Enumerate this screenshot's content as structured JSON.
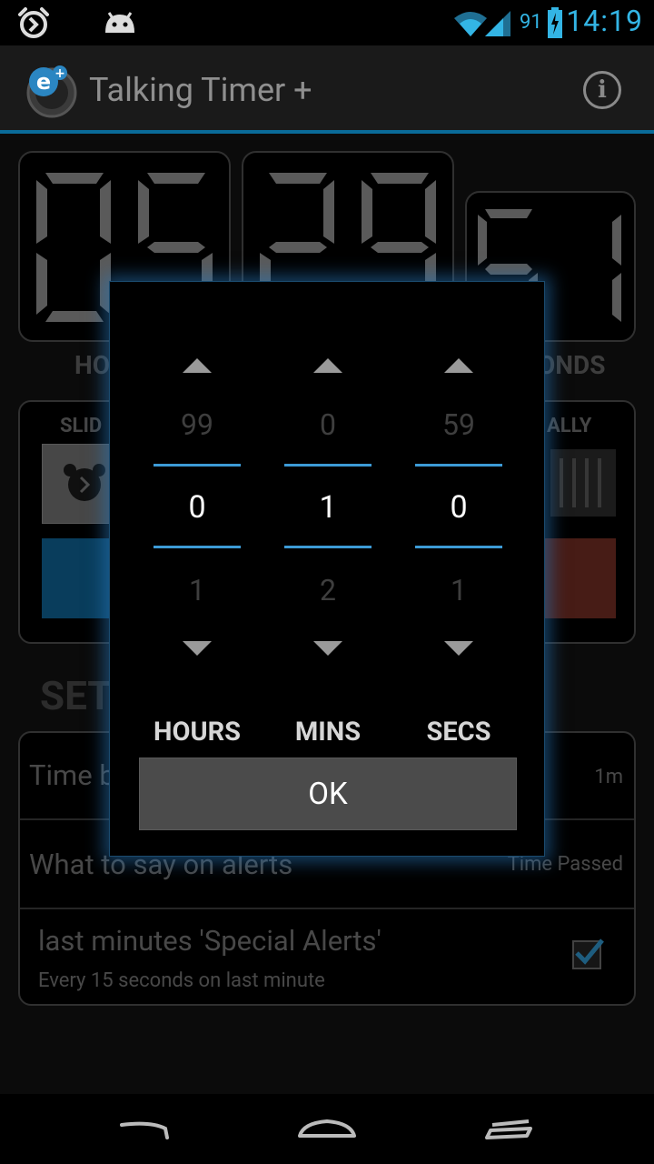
{
  "status_bar": {
    "battery_percent": "91",
    "time": "14:19",
    "icons": [
      "alarm-icon",
      "android-icon",
      "wifi-icon",
      "signal-icon",
      "battery-charging-icon"
    ]
  },
  "action_bar": {
    "title": "Talking Timer +",
    "logo_icon": "app-logo-icon",
    "info_icon": "info-icon",
    "info_glyph": "i"
  },
  "timer_display": {
    "hours": "05",
    "minutes": "29",
    "seconds": "51",
    "hours_label": "HO",
    "seconds_label": "ONDS"
  },
  "mode_panel": {
    "left_label": "SLID",
    "right_label": "ALLY"
  },
  "settings": {
    "section_title": "SET",
    "rows": [
      {
        "label": "Time b",
        "value": "1m"
      },
      {
        "label": "What to say on alerts",
        "value": "Time Passed"
      },
      {
        "label": "last minutes 'Special Alerts'",
        "subtitle": "Every 15 seconds on last minute",
        "checked": true
      }
    ]
  },
  "dialog": {
    "columns": [
      {
        "key": "hours",
        "prev": "99",
        "current": "0",
        "next": "1",
        "label": "HOURS"
      },
      {
        "key": "mins",
        "prev": "0",
        "current": "1",
        "next": "2",
        "label": "MINS"
      },
      {
        "key": "secs",
        "prev": "59",
        "current": "0",
        "next": "1",
        "label": "SECS"
      }
    ],
    "ok_label": "OK"
  },
  "nav_bar": {
    "icons": [
      "back-icon",
      "home-icon",
      "recents-icon"
    ]
  },
  "colors": {
    "accent": "#33b5e5",
    "picker_divider": "#3d9bd6",
    "ok_button": "#4b4b4b"
  }
}
